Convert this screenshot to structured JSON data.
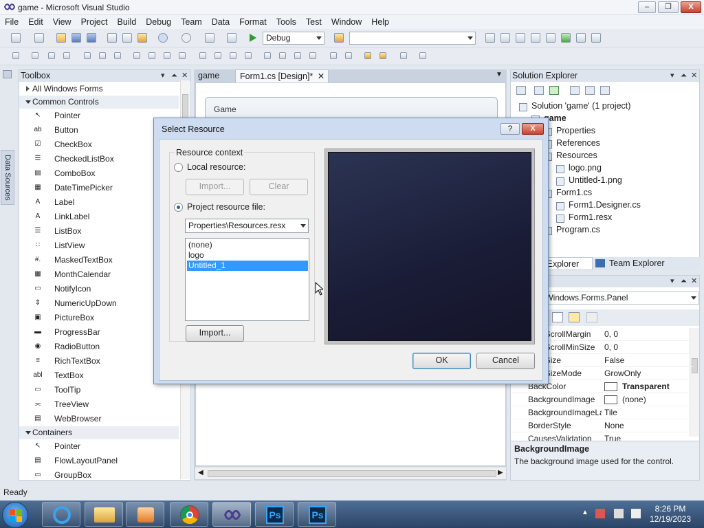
{
  "window": {
    "title": "game - Microsoft Visual Studio",
    "minimize": "–",
    "maximize": "❐",
    "close": "X"
  },
  "menu": [
    "File",
    "Edit",
    "View",
    "Project",
    "Build",
    "Debug",
    "Team",
    "Data",
    "Format",
    "Tools",
    "Test",
    "Window",
    "Help"
  ],
  "toolbar": {
    "configuration": "Debug",
    "platform": ""
  },
  "datasources_tab": "Data Sources",
  "toolbox": {
    "title": "Toolbox",
    "categories": {
      "all": "All Windows Forms",
      "common": "Common Controls",
      "containers": "Containers"
    },
    "common_items": [
      {
        "label": "Pointer",
        "glyph": "↖"
      },
      {
        "label": "Button",
        "glyph": "ab"
      },
      {
        "label": "CheckBox",
        "glyph": "☑"
      },
      {
        "label": "CheckedListBox",
        "glyph": "☰"
      },
      {
        "label": "ComboBox",
        "glyph": "▤"
      },
      {
        "label": "DateTimePicker",
        "glyph": "▦"
      },
      {
        "label": "Label",
        "glyph": "A"
      },
      {
        "label": "LinkLabel",
        "glyph": "A"
      },
      {
        "label": "ListBox",
        "glyph": "☰"
      },
      {
        "label": "ListView",
        "glyph": "∷"
      },
      {
        "label": "MaskedTextBox",
        "glyph": "#."
      },
      {
        "label": "MonthCalendar",
        "glyph": "▦"
      },
      {
        "label": "NotifyIcon",
        "glyph": "▭"
      },
      {
        "label": "NumericUpDown",
        "glyph": "⇕"
      },
      {
        "label": "PictureBox",
        "glyph": "▣"
      },
      {
        "label": "ProgressBar",
        "glyph": "▬"
      },
      {
        "label": "RadioButton",
        "glyph": "◉"
      },
      {
        "label": "RichTextBox",
        "glyph": "≡"
      },
      {
        "label": "TextBox",
        "glyph": "abl"
      },
      {
        "label": "ToolTip",
        "glyph": "▭"
      },
      {
        "label": "TreeView",
        "glyph": "⫘"
      },
      {
        "label": "WebBrowser",
        "glyph": "▤"
      }
    ],
    "container_items": [
      {
        "label": "Pointer",
        "glyph": "↖"
      },
      {
        "label": "FlowLayoutPanel",
        "glyph": "▤"
      },
      {
        "label": "GroupBox",
        "glyph": "▭"
      }
    ]
  },
  "documents": {
    "tabs": [
      {
        "label": "game",
        "active": false
      },
      {
        "label": "Form1.cs [Design]*",
        "active": true
      }
    ],
    "form_caption": "Game"
  },
  "solution_explorer": {
    "title": "Solution Explorer",
    "nodes": [
      {
        "label": "Solution 'game' (1 project)",
        "level": 0
      },
      {
        "label": "game",
        "level": 1,
        "bold": true
      },
      {
        "label": "Properties",
        "level": 2
      },
      {
        "label": "References",
        "level": 2
      },
      {
        "label": "Resources",
        "level": 2
      },
      {
        "label": "logo.png",
        "level": 3
      },
      {
        "label": "Untitled-1.png",
        "level": 3
      },
      {
        "label": "Form1.cs",
        "level": 2
      },
      {
        "label": "Form1.Designer.cs",
        "level": 3
      },
      {
        "label": "Form1.resx",
        "level": 3
      },
      {
        "label": "Program.cs",
        "level": 2
      }
    ],
    "tabs": [
      "Solution Explorer",
      "Team Explorer"
    ]
  },
  "properties": {
    "object": "System.Windows.Forms.Panel",
    "rows": [
      {
        "name": "AutoScrollMargin",
        "value": "0, 0"
      },
      {
        "name": "AutoScrollMinSize",
        "value": "0, 0"
      },
      {
        "name": "AutoSize",
        "value": "False"
      },
      {
        "name": "AutoSizeMode",
        "value": "GrowOnly"
      },
      {
        "name": "BackColor",
        "value": "Transparent",
        "swatch": true,
        "bold": true
      },
      {
        "name": "BackgroundImage",
        "value": "(none)",
        "swatch": true
      },
      {
        "name": "BackgroundImageLayout",
        "value": "Tile"
      },
      {
        "name": "BorderStyle",
        "value": "None"
      },
      {
        "name": "CausesValidation",
        "value": "True"
      }
    ],
    "desc_title": "BackgroundImage",
    "desc_text": "The background image used for the control."
  },
  "status": "Ready",
  "clock": {
    "time": "8:26 PM",
    "date": "12/19/2023"
  },
  "dialog": {
    "title": "Select Resource",
    "help": "?",
    "close": "X",
    "group_label": "Resource context",
    "local_label": "Local resource:",
    "import_disabled": "Import...",
    "clear": "Clear",
    "project_label": "Project resource file:",
    "resx_file": "Properties\\Resources.resx",
    "resources": [
      {
        "label": "(none)",
        "selected": false
      },
      {
        "label": "logo",
        "selected": false
      },
      {
        "label": "Untitled_1",
        "selected": true
      }
    ],
    "import": "Import...",
    "ok": "OK",
    "cancel": "Cancel"
  },
  "colors": {
    "selection": "#3399ff",
    "preview_dark": "#1a1c36",
    "taskbar": "#2a4466"
  }
}
